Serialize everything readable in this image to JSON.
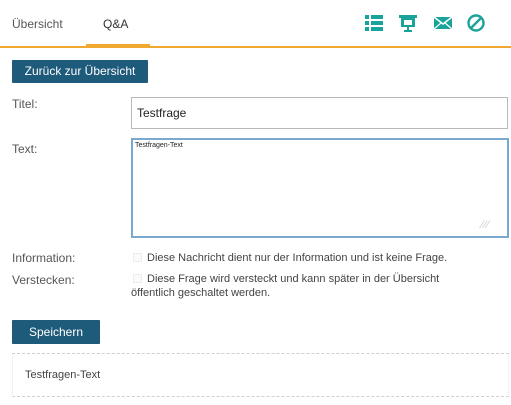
{
  "tabs": {
    "overview_label": "Übersicht",
    "qa_label": "Q&A"
  },
  "toolbar": {
    "icons": [
      "list-icon",
      "presentation-icon",
      "mail-icon",
      "block-icon"
    ],
    "icon_color": "#1aa39a",
    "accent_color": "#f0a830"
  },
  "back_button": {
    "label": "Zurück zur Übersicht"
  },
  "form": {
    "title_label": "Titel:",
    "title_value": "Testfrage",
    "text_label": "Text:",
    "text_value": "Testfragen-Text",
    "info_label": "Information:",
    "info_checkbox_text": "Diese Nachricht dient nur der Information und ist keine Frage.",
    "hide_label": "Verstecken:",
    "hide_checkbox_text_line1": "Diese Frage wird versteckt und kann später in der Übersicht",
    "hide_checkbox_text_line2": "öffentlich geschaltet werden.",
    "save_label": "Speichern"
  },
  "preview": {
    "text": "Testfragen-Text"
  },
  "colors": {
    "button_bg": "#1e5a7a",
    "textarea_border": "#7aa8cf"
  }
}
